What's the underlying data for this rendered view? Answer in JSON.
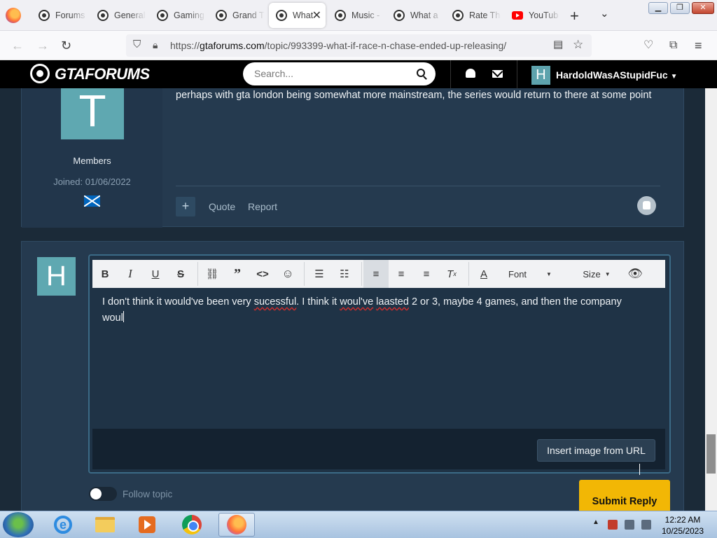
{
  "browser": {
    "tabs": [
      {
        "label": "Forums",
        "icon": "site-icon"
      },
      {
        "label": "General",
        "icon": "site-icon"
      },
      {
        "label": "Gaming",
        "icon": "site-icon"
      },
      {
        "label": "Grand T",
        "icon": "site-icon"
      },
      {
        "label": "What",
        "icon": "site-icon",
        "active": true
      },
      {
        "label": "Music -",
        "icon": "site-icon"
      },
      {
        "label": "What a",
        "icon": "site-icon"
      },
      {
        "label": "Rate Th",
        "icon": "site-icon"
      },
      {
        "label": "YouTub",
        "icon": "youtube-icon"
      }
    ],
    "url_prefix": "https://",
    "url_domain": "gtaforums.com",
    "url_path": "/topic/993399-what-if-race-n-chase-ended-up-releasing/"
  },
  "site": {
    "logo": "GTAFORUMS",
    "search_placeholder": "Search...",
    "user_initial": "H",
    "user_name": "HardoldWasAStupidFuc"
  },
  "post": {
    "avatar_letter": "T",
    "group": "Members",
    "joined": "Joined: 01/06/2022",
    "text": "perhaps with gta london being somewhat more mainstream, the series would return to there at some point",
    "actions": {
      "quote": "Quote",
      "report": "Report"
    }
  },
  "reply": {
    "avatar_letter": "H",
    "toolbar": {
      "font": "Font",
      "size": "Size"
    },
    "compose": {
      "part1": "I don't think it would've been very ",
      "misspelled1": "sucessful",
      "part2": ". I think it ",
      "misspelled2": "woul've",
      "part3": " ",
      "misspelled3": "laasted",
      "part4": " 2 or 3, maybe 4 games, and then the company\nwoul"
    },
    "insert_image_label": "Insert image from URL",
    "follow_label": "Follow topic",
    "submit_label": "Submit Reply"
  },
  "taskbar": {
    "time": "12:22 AM",
    "date": "10/25/2023"
  },
  "colors": {
    "accent": "#f2b705",
    "avatar": "#5fa8b1",
    "background": "#1b2a38",
    "panel": "#253a4f"
  }
}
